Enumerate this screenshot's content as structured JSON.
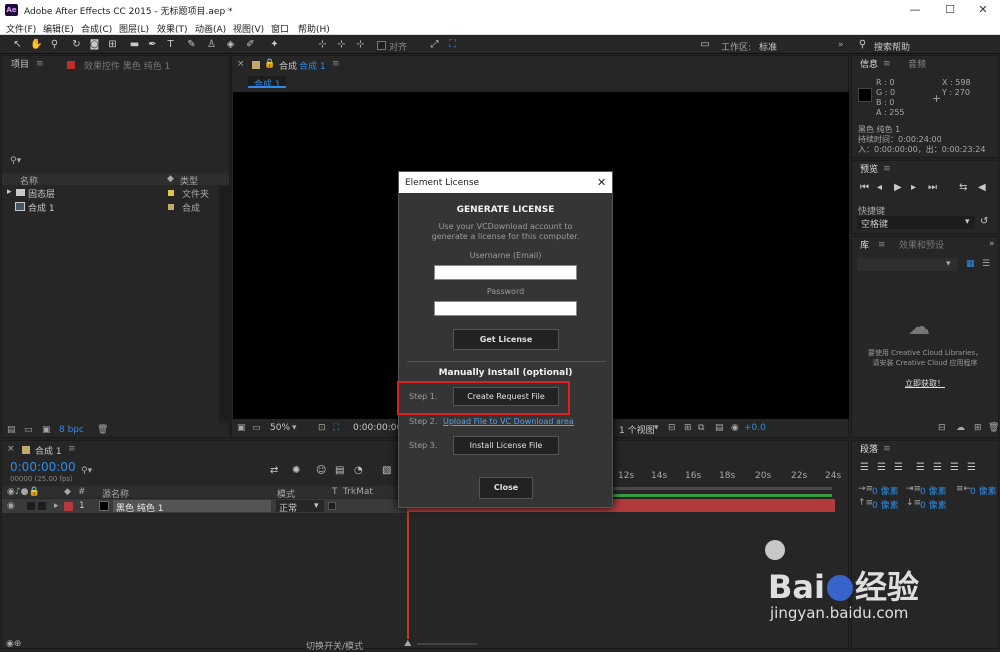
{
  "app": {
    "title": "Adobe After Effects CC 2015 - 无标题项目.aep *",
    "logo": "Ae"
  },
  "window": {
    "min": "—",
    "max": "☐",
    "close": "✕"
  },
  "menu": [
    "文件(F)",
    "编辑(E)",
    "合成(C)",
    "图层(L)",
    "效果(T)",
    "动画(A)",
    "视图(V)",
    "窗口",
    "帮助(H)"
  ],
  "toolbar": {
    "align_label": "对齐",
    "workspace_label": "工作区:",
    "workspace_value": "标准",
    "search_help": "搜索帮助"
  },
  "project": {
    "tab": "项目",
    "effects_tab": "效果控件 黑色 纯色 1",
    "col_name": "名称",
    "col_type": "类型",
    "items": [
      {
        "name": "固态层",
        "type": "文件夹"
      },
      {
        "name": "合成 1",
        "type": "合成"
      }
    ],
    "bpc": "8 bpc"
  },
  "comp": {
    "tab": "合成 合成 1",
    "tab_prefix": "合成",
    "tab_name": "合成 1",
    "subtab": "合成 1",
    "zoom": "50%",
    "timecode": "0:00:00:00",
    "view": "1 个视图",
    "exposure": "+0.0"
  },
  "info": {
    "tab": "信息",
    "audio_tab": "音频",
    "r": "R : 0",
    "g": "G : 0",
    "b": "B : 0",
    "a": "A : 255",
    "x": "X : 598",
    "y": "Y : 270",
    "layer": "黑色 纯色 1",
    "duration": "持续时间：0:00:24:00",
    "inout": "入：0:00:00:00，出：0:00:23:24"
  },
  "preview": {
    "tab": "预览",
    "shortcut_label": "快捷键",
    "shortcut_value": "空格键"
  },
  "library": {
    "tab": "库",
    "effects_tab": "效果和预设",
    "cc_msg1": "要使用 Creative Cloud Libraries，",
    "cc_msg2": "请安装 Creative Cloud 应用程序",
    "cc_link": "立即获取！"
  },
  "paragraph": {
    "tab": "段落",
    "px": [
      "0 像素",
      "0 像素",
      "0 像素",
      "0 像素",
      "0 像素"
    ]
  },
  "timeline": {
    "tab": "合成 1",
    "timecode": "0:00:00:00",
    "fps": "00000 (25.00 fps)",
    "col_source": "源名称",
    "col_mode": "模式",
    "col_t": "T",
    "col_trkmat": "TrkMat",
    "layer_num": "1",
    "layer_name": "黑色 纯色 1",
    "layer_mode": "正常",
    "ruler": [
      "12s",
      "14s",
      "16s",
      "18s",
      "20s",
      "22s",
      "24s"
    ],
    "toggle": "切换开关/模式"
  },
  "dialog": {
    "title": "Element License",
    "heading": "GENERATE LICENSE",
    "desc1": "Use your VCDownload account to",
    "desc2": "generate a license for this computer.",
    "username_label": "Username (Email)",
    "password_label": "Password",
    "get_license": "Get License",
    "manual_heading": "Manually Install (optional)",
    "step1": "Step 1.",
    "create_request": "Create Request File",
    "step2": "Step 2.",
    "upload_link": "Upload File to VC Download area",
    "step3": "Step 3.",
    "install_license": "Install License File",
    "close": "Close"
  },
  "watermark": {
    "brand": "Bai",
    "brand2": "经验",
    "url": "jingyan.baidu.com"
  },
  "colors": {
    "accent_blue": "#2d8ceb",
    "highlight_red": "#e02020",
    "layer_red": "#b33a3a"
  }
}
